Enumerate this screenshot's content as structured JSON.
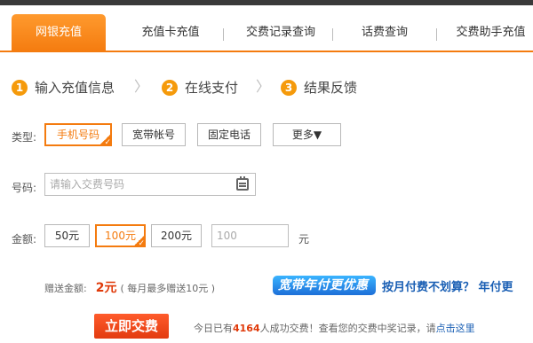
{
  "tabs": [
    {
      "label": "网银充值"
    },
    {
      "label": "充值卡充值"
    },
    {
      "label": "交费记录查询"
    },
    {
      "label": "话费查询"
    },
    {
      "label": "交费助手充值"
    }
  ],
  "steps": [
    {
      "num": "1",
      "label": "输入充值信息"
    },
    {
      "num": "2",
      "label": "在线支付"
    },
    {
      "num": "3",
      "label": "结果反馈"
    }
  ],
  "step_separator": "〉",
  "type_row": {
    "label": "类型:",
    "options": [
      "手机号码",
      "宽带帐号",
      "固定电话",
      "更多▼"
    ],
    "selected": "手机号码"
  },
  "number_row": {
    "label": "号码:",
    "placeholder": "请输入交费号码"
  },
  "amount_row": {
    "label": "金额:",
    "options": [
      "50元",
      "100元",
      "200元"
    ],
    "selected": "100元",
    "custom_placeholder": "100",
    "unit": "元"
  },
  "gift": {
    "label": "赠送金额:",
    "amount": "2元",
    "note": "( 每月最多赠送10元 )"
  },
  "promo": {
    "badge": "宽带年付更优惠",
    "text": "按月付费不划算？ 年付更"
  },
  "submit_label": "立即交费",
  "footnote": {
    "prefix": "今日已有",
    "count": "4164",
    "middle": "人成功交费！查看您的交费中奖记录，请",
    "link": "点击这里"
  },
  "colors": {
    "accent": "#f47b0f",
    "link": "#1a5fb4",
    "alert": "#e03a0a"
  }
}
